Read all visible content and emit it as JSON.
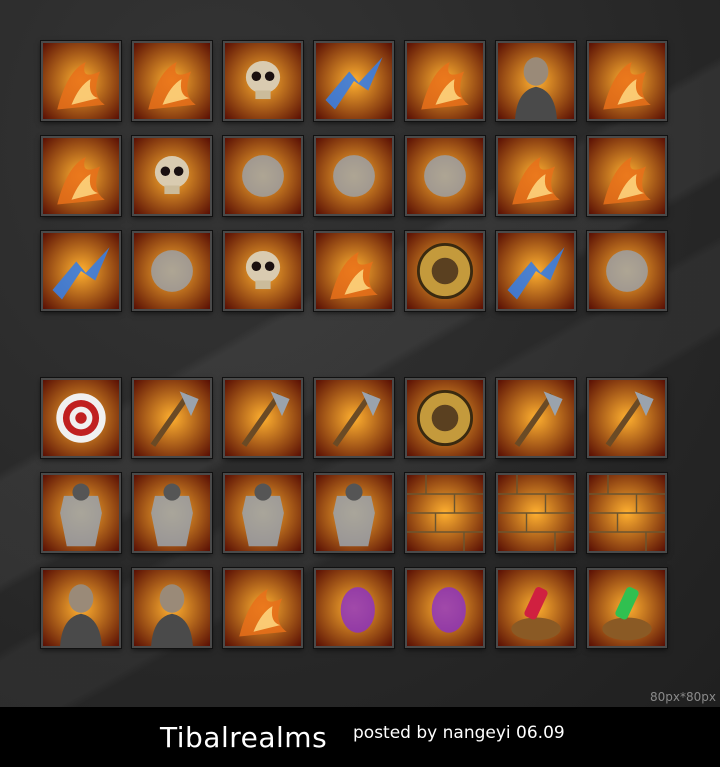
{
  "footer": {
    "title": "Tibalrealms",
    "posted": "posted by nangeyi 06.09"
  },
  "size_note": "80px*80px",
  "icons_top": [
    [
      "fire-sword-slash-icon",
      "flaming-skull-icon",
      "skull-pile-swords-icon",
      "blue-ice-flag-icon",
      "flaming-horse-icon",
      "chained-prisoner-icon",
      "fire-arrow-icon"
    ],
    [
      "fireball-icon",
      "skull-cannon-icon",
      "spiked-palisade-icon",
      "black-dragon-claw-icon",
      "siege-tower-icon",
      "fire-staff-icon",
      "flaming-spear-icon"
    ],
    [
      "blue-aura-figure-icon",
      "gauntlet-fist-icon",
      "skull-medallion-icon",
      "black-shield-fire-icon",
      "bronze-round-shield-icon",
      "lightning-warrior-icon",
      "rolling-wheels-icon"
    ]
  ],
  "icons_bottom": [
    [
      "archery-target-icon",
      "battle-axe-icon",
      "spiked-halberd-icon",
      "pickaxe-icon",
      "spiked-red-shield-icon",
      "saw-blade-weapon-icon",
      "red-dagger-icon"
    ],
    [
      "tan-armor-icon",
      "chain-robe-armor-icon",
      "golden-armor-icon",
      "steel-plate-armor-icon",
      "stone-wall-icon",
      "portcullis-gate-icon",
      "castle-wall-icon"
    ],
    [
      "hooded-figure-icon",
      "blonde-elf-icon",
      "fire-breather-icon",
      "undead-face-icon",
      "purple-shade-icon",
      "red-potion-barrel-icon",
      "green-potion-barrel-icon"
    ]
  ],
  "palette": {
    "fire": "#e8701a",
    "ember": "#ffb030",
    "ice": "#3a7de0",
    "dark": "#101010",
    "steel": "#9aa3ad",
    "gold": "#c49a3c",
    "purple": "#8a30c8",
    "stone": "#c9b27a"
  }
}
